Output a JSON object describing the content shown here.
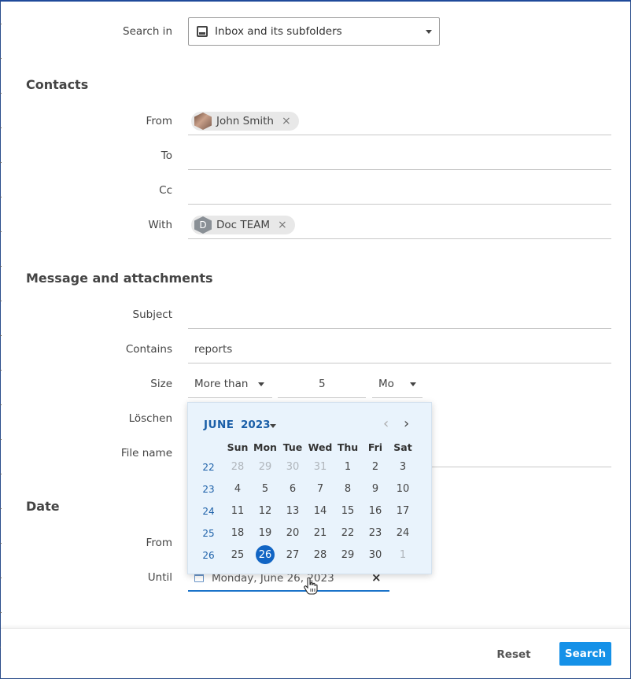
{
  "search_in": {
    "label": "Search in",
    "value": "Inbox and its subfolders"
  },
  "contacts": {
    "heading": "Contacts",
    "from_label": "From",
    "from_chip": "John Smith",
    "to_label": "To",
    "cc_label": "Cc",
    "with_label": "With",
    "with_chip": "Doc TEAM",
    "with_initial": "D",
    "chip_remove": "×"
  },
  "message": {
    "heading": "Message and attachments",
    "subject_label": "Subject",
    "contains_label": "Contains",
    "contains_value": "reports",
    "size_label": "Size",
    "size_op": "More than",
    "size_value": "5",
    "size_unit": "Mo",
    "loeschen_label": "Löschen",
    "filename_label": "File name"
  },
  "date": {
    "heading": "Date",
    "from_label": "From",
    "until_label": "Until",
    "until_value": "Monday, June 26, 2023",
    "clear": "×"
  },
  "calendar": {
    "month": "JUNE",
    "year": "2023",
    "prev": "‹",
    "next": "›",
    "days_of_week": [
      "Sun",
      "Mon",
      "Tue",
      "Wed",
      "Thu",
      "Fri",
      "Sat"
    ],
    "weeks": [
      {
        "wk": "22",
        "days": [
          "28",
          "29",
          "30",
          "31",
          "1",
          "2",
          "3"
        ],
        "muted": [
          0,
          1,
          2,
          3
        ]
      },
      {
        "wk": "23",
        "days": [
          "4",
          "5",
          "6",
          "7",
          "8",
          "9",
          "10"
        ],
        "muted": []
      },
      {
        "wk": "24",
        "days": [
          "11",
          "12",
          "13",
          "14",
          "15",
          "16",
          "17"
        ],
        "muted": []
      },
      {
        "wk": "25",
        "days": [
          "18",
          "19",
          "20",
          "21",
          "22",
          "23",
          "24"
        ],
        "muted": []
      },
      {
        "wk": "26",
        "days": [
          "25",
          "26",
          "27",
          "28",
          "29",
          "30",
          "1"
        ],
        "muted": [
          6
        ]
      }
    ],
    "selected": {
      "week": 4,
      "day": 1
    },
    "accent_color": "#1265c4"
  },
  "footer": {
    "reset": "Reset",
    "search": "Search"
  },
  "colors": {
    "primary": "#1591e8",
    "link": "#1b5fa8",
    "calendar_bg": "#e9f3fc"
  }
}
